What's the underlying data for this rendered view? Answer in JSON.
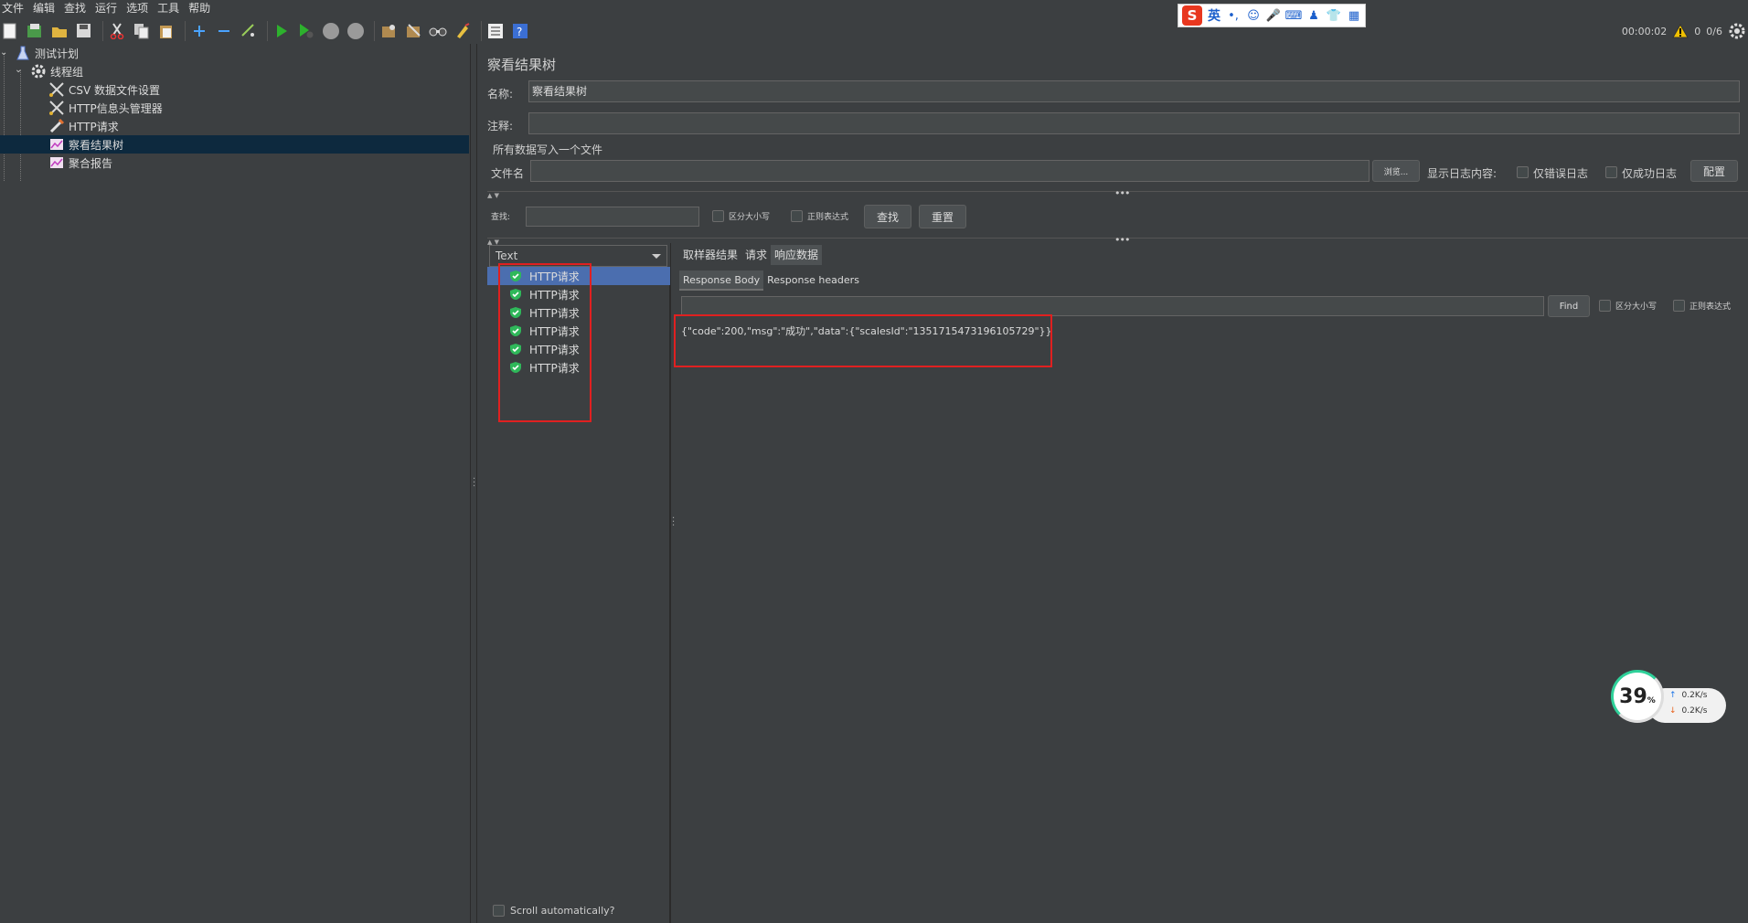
{
  "menu": [
    "文件",
    "编辑",
    "查找",
    "运行",
    "选项",
    "工具",
    "帮助"
  ],
  "status": {
    "elapsed": "00:00:02",
    "warnings": "0",
    "threads": "0/6"
  },
  "ime": {
    "lang": "英",
    "punct": "•,"
  },
  "tree": {
    "items": [
      {
        "label": "测试计划",
        "icon": "flask-icon"
      },
      {
        "label": "线程组",
        "icon": "gear-icon"
      },
      {
        "label": "CSV 数据文件设置",
        "icon": "wrench-icon"
      },
      {
        "label": "HTTP信息头管理器",
        "icon": "wrench-icon"
      },
      {
        "label": "HTTP请求",
        "icon": "pipette-icon"
      },
      {
        "label": "察看结果树",
        "icon": "graph-icon"
      },
      {
        "label": "聚合报告",
        "icon": "graph-icon"
      }
    ]
  },
  "panel": {
    "title": "察看结果树",
    "name_label": "名称:",
    "name_value": "察看结果树",
    "comment_label": "注释:",
    "comment_value": "",
    "file_section": "所有数据写入一个文件",
    "filename_label": "文件名",
    "filename_value": "",
    "browse_label": "浏览...",
    "log_label": "显示日志内容:",
    "errors_only": "仅错误日志",
    "success_only": "仅成功日志",
    "configure": "配置",
    "search_label": "查找:",
    "case_sensitive": "区分大小写",
    "regex": "正则表达式",
    "find_button": "查找",
    "reset_button": "重置"
  },
  "results": {
    "renderer": "Text",
    "items": [
      "HTTP请求",
      "HTTP请求",
      "HTTP请求",
      "HTTP请求",
      "HTTP请求",
      "HTTP请求"
    ],
    "scroll_auto": "Scroll automatically?"
  },
  "detail": {
    "tabs": [
      "取样器结果",
      "请求",
      "响应数据"
    ],
    "subtabs": [
      "Response Body",
      "Response headers"
    ],
    "find_button": "Find",
    "case_sensitive": "区分大小写",
    "regex": "正则表达式",
    "body": "{\"code\":200,\"msg\":\"成功\",\"data\":{\"scalesId\":\"1351715473196105729\"}}"
  },
  "speed": {
    "percent": "39",
    "unit": "%",
    "up": "0.2K/s",
    "down": "0.2K/s"
  },
  "colors": {
    "selected_tree": "#0d293e",
    "selected_result": "#4b6eaf",
    "highlight": "#e02020",
    "success": "#2fb85a"
  }
}
